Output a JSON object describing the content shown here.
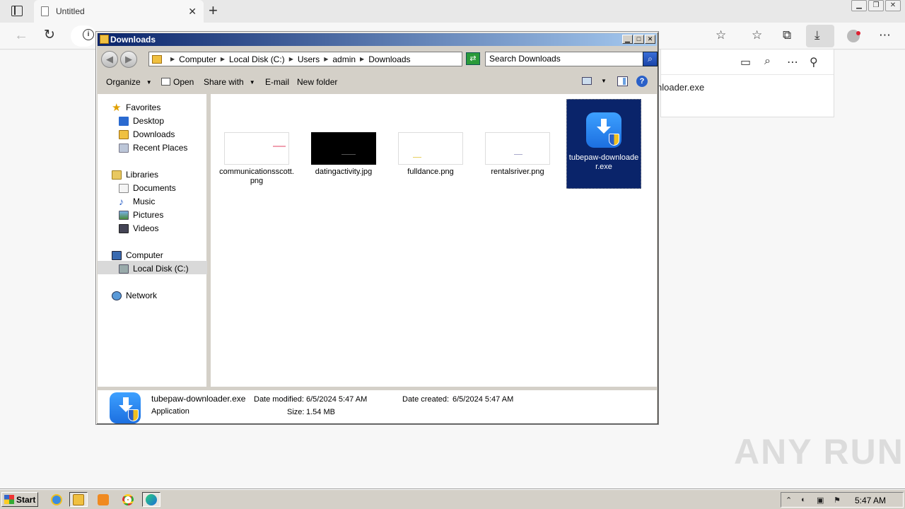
{
  "browser": {
    "tab_title": "Untitled",
    "tab_close": "✕",
    "new_tab": "+",
    "window_buttons": [
      "▁",
      "❐",
      "✕"
    ],
    "downloads_panel": {
      "visible_item": "nloader.exe"
    }
  },
  "explorer": {
    "title": "Downloads",
    "title_buttons": [
      "▁",
      "□",
      "✕"
    ],
    "breadcrumb": [
      "Computer",
      "Local Disk (C:)",
      "Users",
      "admin",
      "Downloads"
    ],
    "search_placeholder": "Search Downloads",
    "commands": {
      "organize": "Organize",
      "open": "Open",
      "share_with": "Share with",
      "email": "E-mail",
      "new_folder": "New folder"
    },
    "nav": {
      "favorites": "Favorites",
      "desktop": "Desktop",
      "downloads": "Downloads",
      "recent_places": "Recent Places",
      "libraries": "Libraries",
      "documents": "Documents",
      "music": "Music",
      "pictures": "Pictures",
      "videos": "Videos",
      "computer": "Computer",
      "local_disk": "Local Disk (C:)",
      "network": "Network"
    },
    "files": [
      {
        "name": "communicationsscott.png"
      },
      {
        "name": "datingactivity.jpg"
      },
      {
        "name": "fulldance.png"
      },
      {
        "name": "rentalsriver.png"
      },
      {
        "name": "tubepaw-downloader.exe"
      }
    ],
    "details": {
      "name": "tubepaw-downloader.exe",
      "type": "Application",
      "date_modified_label": "Date modified:",
      "date_modified": "6/5/2024 5:47 AM",
      "size_label": "Size:",
      "size": "1.54 MB",
      "date_created_label": "Date created:",
      "date_created": "6/5/2024 5:47 AM"
    }
  },
  "taskbar": {
    "start_label": "Start",
    "clock": "5:47 AM"
  },
  "watermark": "ANY RUN"
}
